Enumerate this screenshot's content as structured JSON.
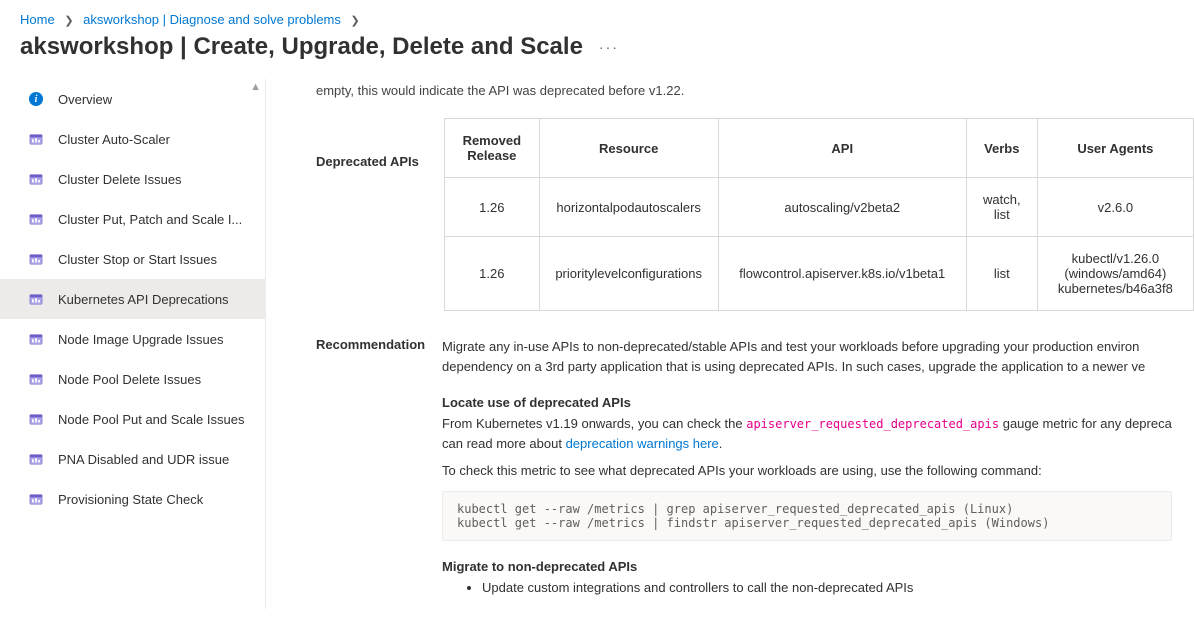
{
  "breadcrumb": {
    "home": "Home",
    "level1": "aksworkshop | Diagnose and solve problems"
  },
  "page_title": "aksworkshop | Create, Upgrade, Delete and Scale",
  "sidebar": {
    "items": [
      {
        "label": "Overview"
      },
      {
        "label": "Cluster Auto-Scaler"
      },
      {
        "label": "Cluster Delete Issues"
      },
      {
        "label": "Cluster Put, Patch and Scale I..."
      },
      {
        "label": "Cluster Stop or Start Issues"
      },
      {
        "label": "Kubernetes API Deprecations"
      },
      {
        "label": "Node Image Upgrade Issues"
      },
      {
        "label": "Node Pool Delete Issues"
      },
      {
        "label": "Node Pool Put and Scale Issues"
      },
      {
        "label": "PNA Disabled and UDR issue"
      },
      {
        "label": "Provisioning State Check"
      }
    ],
    "selected_index": 5
  },
  "intro_fragment": "empty, this would indicate the API was deprecated before v1.22.",
  "table": {
    "caption": "Deprecated APIs",
    "headers": {
      "removed": "Removed Release",
      "resource": "Resource",
      "api": "API",
      "verbs": "Verbs",
      "ua": "User Agents"
    },
    "rows": [
      {
        "removed": "1.26",
        "resource": "horizontalpodautoscalers",
        "api": "autoscaling/v2beta2",
        "verbs": "watch, list",
        "ua": "v2.6.0"
      },
      {
        "removed": "1.26",
        "resource": "prioritylevelconfigurations",
        "api": "flowcontrol.apiserver.k8s.io/v1beta1",
        "verbs": "list",
        "ua": "kubectl/v1.26.0 (windows/amd64) kubernetes/b46a3f8"
      }
    ]
  },
  "reco": {
    "label": "Recommendation",
    "summary_a": "Migrate any in-use APIs to non-deprecated/stable APIs and test your workloads before upgrading your production environ",
    "summary_b": "dependency on a 3rd party application that is using deprecated APIs. In such cases, upgrade the application to a newer ve",
    "locate_h": "Locate use of deprecated APIs",
    "locate_p_pre": "From Kubernetes v1.19 onwards, you can check the ",
    "locate_metric": "apiserver_requested_deprecated_apis",
    "locate_p_post": " gauge metric for any depreca",
    "locate_p2_pre": "can read more about ",
    "locate_link": "deprecation warnings here",
    "check_p": "To check this metric to see what deprecated APIs your workloads are using, use the following command:",
    "cmd": "kubectl get --raw /metrics | grep apiserver_requested_deprecated_apis (Linux)\nkubectl get --raw /metrics | findstr apiserver_requested_deprecated_apis (Windows)",
    "migrate_h": "Migrate to non-deprecated APIs",
    "bullets": [
      "Update custom integrations and controllers to call the non-deprecated APIs"
    ]
  }
}
